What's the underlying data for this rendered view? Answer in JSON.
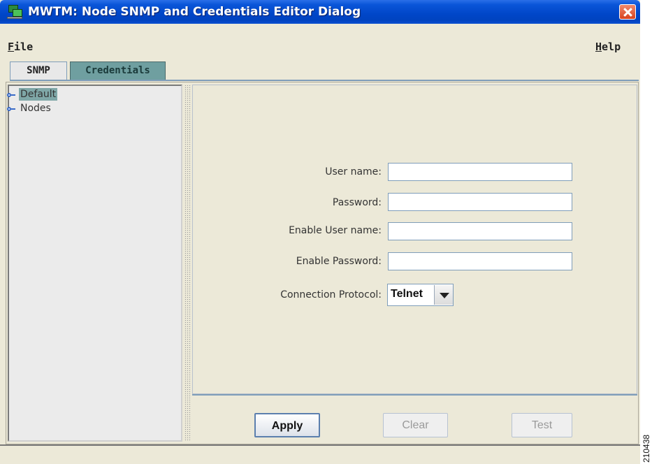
{
  "window": {
    "title": "MWTM: Node SNMP and Credentials Editor Dialog",
    "app_icon": "network-monitor-icon",
    "close_icon": "close-icon"
  },
  "menubar": {
    "file_label": "File",
    "help_label": "Help"
  },
  "tabs": [
    {
      "label": "SNMP",
      "selected": false
    },
    {
      "label": "Credentials",
      "selected": true
    }
  ],
  "tree": {
    "items": [
      {
        "label": "Default",
        "icon": "tree-node-icon",
        "selected": true
      },
      {
        "label": "Nodes",
        "icon": "tree-node-icon",
        "selected": false
      }
    ]
  },
  "form": {
    "user_name": {
      "label": "User name:",
      "value": ""
    },
    "password": {
      "label": "Password:",
      "value": ""
    },
    "enable_user_name": {
      "label": "Enable User name:",
      "value": ""
    },
    "enable_password": {
      "label": "Enable Password:",
      "value": ""
    },
    "connection_protocol": {
      "label": "Connection Protocol:",
      "value": "Telnet",
      "dropdown_icon": "chevron-down-icon"
    }
  },
  "buttons": {
    "apply": {
      "label": "Apply",
      "enabled": true
    },
    "clear": {
      "label": "Clear",
      "enabled": false
    },
    "test": {
      "label": "Test",
      "enabled": false
    }
  },
  "figure_id": "210438",
  "colors": {
    "titlebar": "#0046c8",
    "selected_tab": "#6f9fa0",
    "selected_tree_item": "#7fa7a7",
    "label_text": "#333333"
  }
}
